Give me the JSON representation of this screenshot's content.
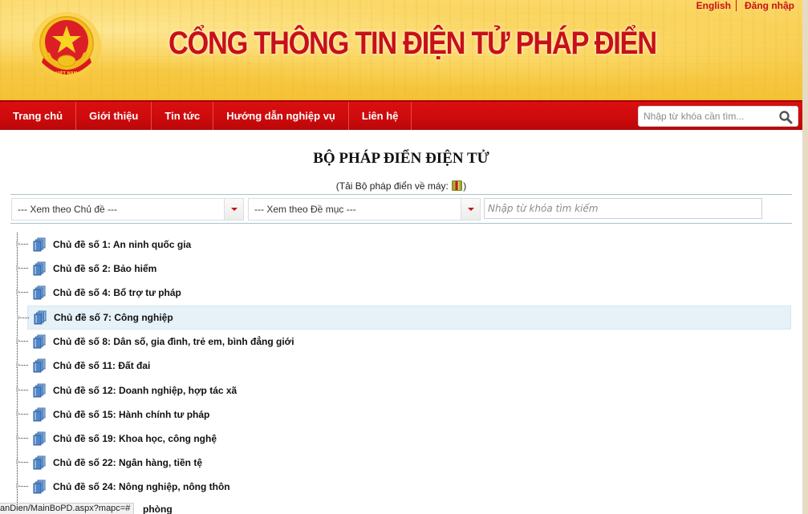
{
  "header": {
    "site_title": "CỔNG THÔNG TIN ĐIỆN TỬ PHÁP ĐIỂN",
    "emblem_text": "VIỆT NAM",
    "top_links": [
      {
        "label": "English"
      },
      {
        "label": "Đăng nhập"
      }
    ]
  },
  "nav": {
    "items": [
      {
        "label": "Trang chủ"
      },
      {
        "label": "Giới thiệu"
      },
      {
        "label": "Tin tức"
      },
      {
        "label": "Hướng dẫn nghiệp vụ"
      },
      {
        "label": "Liên hệ"
      }
    ],
    "search_placeholder": "Nhập từ khóa cần tìm..."
  },
  "content": {
    "title": "BỘ PHÁP ĐIỂN ĐIỆN TỬ",
    "download_prefix": "(Tải Bộ pháp điển về máy: ",
    "download_suffix": ")",
    "filters": {
      "topic_select": "--- Xem theo Chủ đề ---",
      "section_select": "--- Xem theo Đề mục ---",
      "keyword_placeholder": "Nhập từ khóa tìm kiếm"
    },
    "tree": [
      {
        "label": "Chủ đề số 1: An ninh quốc gia"
      },
      {
        "label": "Chủ đề số 2: Bảo hiểm"
      },
      {
        "label": "Chủ đề số 4: Bổ trợ tư pháp"
      },
      {
        "label": "Chủ đề số 7: Công nghiệp",
        "highlighted": true
      },
      {
        "label": "Chủ đề số 8: Dân số, gia đình, trẻ em, bình đẳng giới"
      },
      {
        "label": "Chủ đề số 11: Đất đai"
      },
      {
        "label": "Chủ đề số 12: Doanh nghiệp, hợp tác xã"
      },
      {
        "label": "Chủ đề số 15: Hành chính tư pháp"
      },
      {
        "label": "Chủ đề số 19: Khoa học, công nghệ"
      },
      {
        "label": "Chủ đề số 22: Ngân hàng, tiền tệ"
      },
      {
        "label": "Chủ đề số 24: Nông nghiệp, nông thôn"
      }
    ],
    "partial_next_item": "phòng"
  },
  "status_bar": {
    "url": "anDien/MainBoPD.aspx?mapc=#"
  },
  "colors": {
    "brand_red": "#cc0a0c",
    "banner_yellow": "#f8cc4a",
    "highlight_row": "#e6f1f8"
  }
}
